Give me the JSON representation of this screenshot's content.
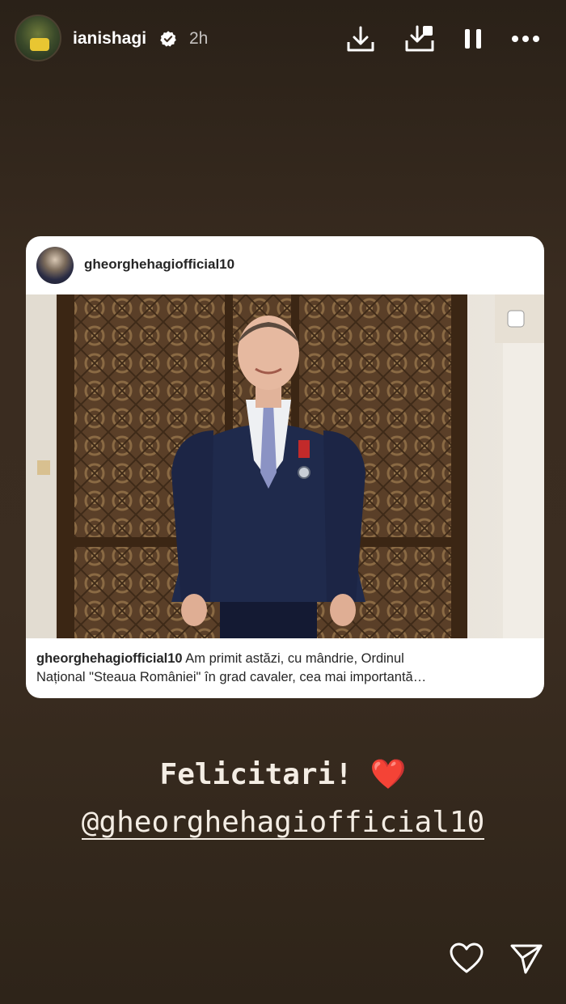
{
  "header": {
    "username": "ianishagi",
    "time": "2h",
    "icons": [
      "download-icon",
      "save-icon",
      "pause-icon",
      "more-icon"
    ]
  },
  "shared_post": {
    "username": "gheorghehagiofficial10",
    "caption_user": "gheorghehagiofficial10",
    "caption_line1": " Am primit astăzi, cu mândrie, Ordinul",
    "caption_line2": "Național \"Steaua României\" în grad cavaler, cea mai importantă…"
  },
  "story_text": {
    "greeting": "Felicitari! ",
    "heart": "❤️",
    "mention": "@gheorghehagiofficial10"
  },
  "footer": {
    "icons": [
      "heart-icon",
      "send-icon"
    ]
  },
  "colors": {
    "background": "#3a2c20",
    "heart": "#e0242b"
  }
}
